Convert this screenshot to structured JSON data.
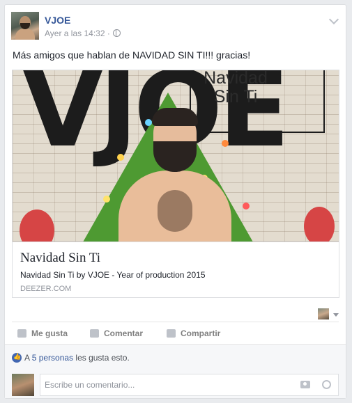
{
  "post": {
    "author": "VJOE",
    "meta_time": "Ayer a las 14:32 ·",
    "privacy_icon": "globe-icon",
    "text": "Más amigos que hablan de NAVIDAD SIN TI!!! gracias!"
  },
  "share": {
    "art_logo": "VJOE",
    "art_title_line1": "Navidad",
    "art_title_line2": "Sin Ti",
    "title": "Navidad Sin Ti",
    "description": "Navidad Sin Ti by VJOE - Year of production 2015",
    "domain": "DEEZER.COM"
  },
  "actions": {
    "like": "Me gusta",
    "comment": "Comentar",
    "share": "Compartir"
  },
  "likes": {
    "prefix": "A ",
    "link": "5 personas",
    "suffix": " les gusta esto."
  },
  "comment": {
    "placeholder": "Escribe un comentario..."
  },
  "colors": {
    "link_blue": "#365899",
    "like_blue": "#4267b2",
    "muted": "#90949c"
  }
}
